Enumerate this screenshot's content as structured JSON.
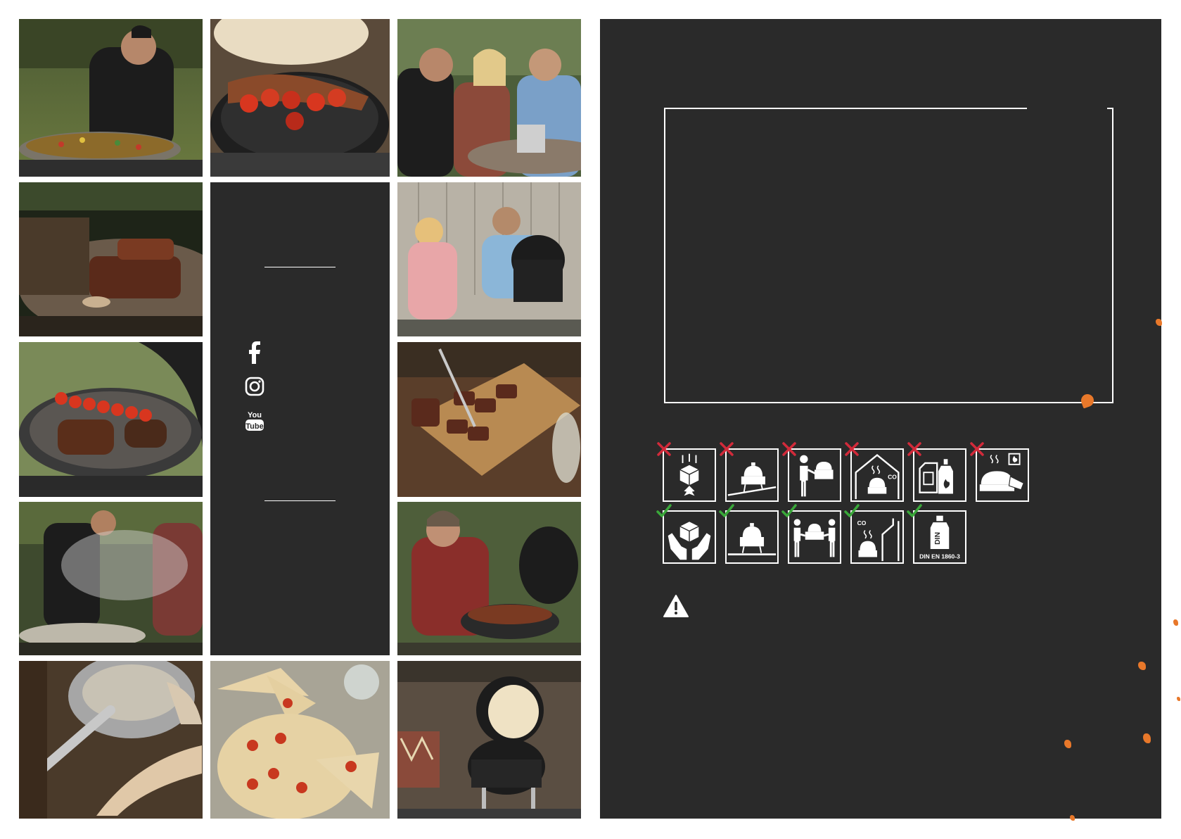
{
  "photos": [
    {
      "id": "chef-plancha",
      "desc_icon": "chef-cooking-photo"
    },
    {
      "id": "kamado-steak-tomatoes",
      "desc_icon": "kamado-grill-photo"
    },
    {
      "id": "friends-dining",
      "desc_icon": "friends-dining-photo"
    },
    {
      "id": "roast-meat-plancha",
      "desc_icon": "roast-meat-photo"
    },
    {
      "id": "couple-wine-kamado",
      "desc_icon": "couple-wine-photo"
    },
    {
      "id": "steak-tomatoes-grid",
      "desc_icon": "steak-tomatoes-photo"
    },
    {
      "id": "sliced-steak-board",
      "desc_icon": "sliced-steak-photo"
    },
    {
      "id": "smoky-plancha",
      "desc_icon": "smoky-grill-photo"
    },
    {
      "id": "man-kamado-tongs",
      "desc_icon": "man-grilling-photo"
    },
    {
      "id": "fish-and-pot",
      "desc_icon": "fish-pot-photo"
    },
    {
      "id": "focaccia",
      "desc_icon": "focaccia-photo"
    },
    {
      "id": "kamado-open-outdoor",
      "desc_icon": "kamado-open-photo"
    }
  ],
  "social": {
    "icons": [
      "facebook-icon",
      "instagram-icon",
      "youtube-icon"
    ],
    "youtube_text_top": "You",
    "youtube_text_bottom": "Tube"
  },
  "safety": {
    "prohibited": [
      "no-dropping-icon",
      "no-sloped-surface-icon",
      "no-carry-alone-icon",
      "no-indoor-co-icon",
      "no-liquid-fuel-icon",
      "no-touch-hot-icon"
    ],
    "recommended": [
      "handle-with-care-icon",
      "level-surface-icon",
      "two-person-carry-icon",
      "outdoor-ventilation-icon",
      "din-firelighter-icon"
    ],
    "co_label": "CO",
    "din_label": "DIN",
    "din_standard": "DIN EN 1860-3"
  },
  "colors": {
    "panel": "#2a2a2a",
    "accent": "#e8782a",
    "cross": "#d22a3a",
    "check": "#3aa83a"
  }
}
